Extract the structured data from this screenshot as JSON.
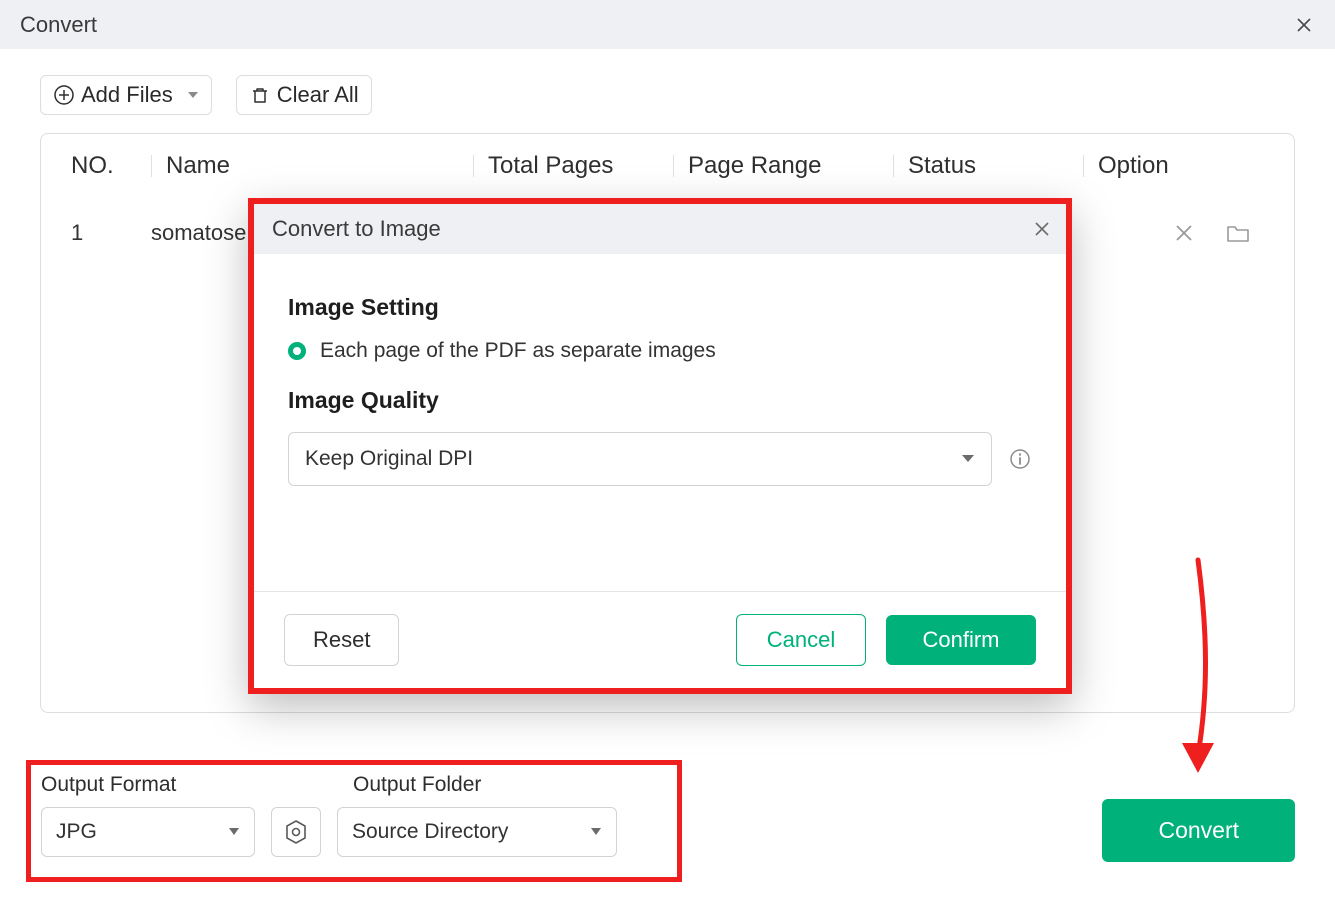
{
  "window": {
    "title": "Convert"
  },
  "toolbar": {
    "addFiles": "Add Files",
    "clearAll": "Clear All"
  },
  "table": {
    "headers": {
      "no": "NO.",
      "name": "Name",
      "pages": "Total Pages",
      "range": "Page Range",
      "status": "Status",
      "option": "Option"
    },
    "rows": [
      {
        "no": "1",
        "name": "somatose"
      }
    ]
  },
  "modal": {
    "title": "Convert to Image",
    "imageSettingHeading": "Image Setting",
    "radioEachPage": "Each page of the PDF as separate images",
    "imageQualityHeading": "Image Quality",
    "qualitySelected": "Keep Original DPI",
    "reset": "Reset",
    "cancel": "Cancel",
    "confirm": "Confirm"
  },
  "output": {
    "formatLabel": "Output Format",
    "folderLabel": "Output Folder",
    "formatSelected": "JPG",
    "folderSelected": "Source Directory"
  },
  "actions": {
    "convert": "Convert"
  }
}
